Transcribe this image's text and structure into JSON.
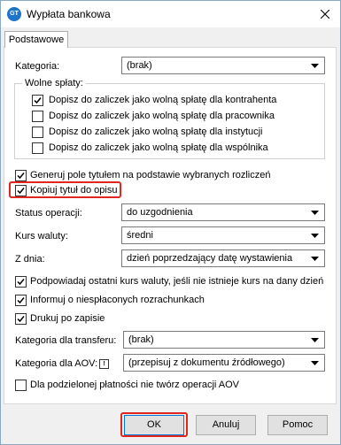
{
  "window": {
    "title": "Wypłata bankowa",
    "icon_text": "GT"
  },
  "tab": {
    "label": "Podstawowe"
  },
  "kategoria": {
    "label": "Kategoria:",
    "value": "(brak)"
  },
  "wolne_splaty": {
    "title": "Wolne spłaty:",
    "items": [
      {
        "label": "Dopisz do zaliczek jako wolną spłatę dla kontrahenta",
        "checked": true
      },
      {
        "label": "Dopisz do zaliczek jako wolną spłatę dla pracownika",
        "checked": false
      },
      {
        "label": "Dopisz do zaliczek jako wolną spłatę dla instytucji",
        "checked": false
      },
      {
        "label": "Dopisz do zaliczek jako wolną spłatę dla wspólnika",
        "checked": false
      }
    ]
  },
  "generuj": {
    "label": "Generuj pole tytułem na podstawie wybranych rozliczeń",
    "checked": true
  },
  "kopiuj": {
    "label": "Kopiuj tytuł do opisu",
    "checked": true
  },
  "status": {
    "label": "Status operacji:",
    "value": "do uzgodnienia"
  },
  "kurs": {
    "label": "Kurs waluty:",
    "value": "średni"
  },
  "z_dnia": {
    "label": "Z dnia:",
    "value": "dzień poprzedzający datę wystawienia"
  },
  "podpowiadaj": {
    "label": "Podpowiadaj ostatni kurs waluty, jeśli nie istnieje kurs na dany dzień",
    "checked": true
  },
  "informuj": {
    "label": "Informuj o niespłaconych rozrachunkach",
    "checked": true
  },
  "drukuj": {
    "label": "Drukuj po zapisie",
    "checked": true
  },
  "kat_transfer": {
    "label": "Kategoria dla transferu:",
    "value": "(brak)"
  },
  "kat_aov": {
    "label": "Kategoria dla AOV:",
    "badge": "!",
    "value": "(przepisuj z dokumentu źródłowego)"
  },
  "podzielona": {
    "label": "Dla podzielonej płatności nie twórz operacji AOV",
    "checked": false
  },
  "buttons": {
    "ok": "OK",
    "anuluj": "Anuluj",
    "pomoc": "Pomoc"
  },
  "colors": {
    "highlight": "#e0261f",
    "accent": "#0078d7",
    "app_icon": "#1e74c9"
  }
}
